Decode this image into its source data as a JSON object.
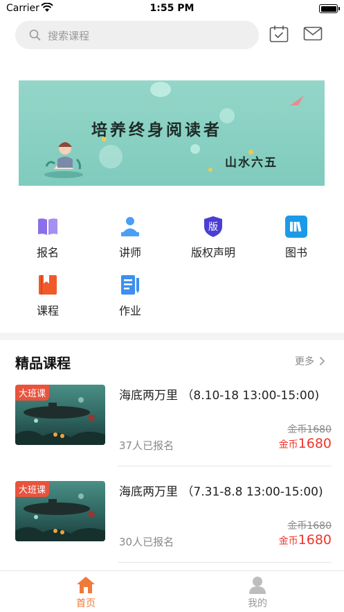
{
  "status_bar": {
    "carrier": "Carrier",
    "time": "1:55 PM"
  },
  "search": {
    "placeholder": "搜索课程"
  },
  "banner": {
    "title": "培养终身阅读者",
    "subtitle": "山水六五"
  },
  "grid": [
    {
      "label": "报名",
      "icon": "open-book-icon",
      "color": "#8b6fe8"
    },
    {
      "label": "讲师",
      "icon": "lecturer-icon",
      "color": "#4a9ff5"
    },
    {
      "label": "版权声明",
      "icon": "copyright-shield-icon",
      "color": "#4b3fd1",
      "glyph": "版"
    },
    {
      "label": "图书",
      "icon": "books-icon",
      "color": "#1b9ae8"
    },
    {
      "label": "课程",
      "icon": "course-book-icon",
      "color": "#f05a2a"
    },
    {
      "label": "作业",
      "icon": "homework-icon",
      "color": "#3d8ff0"
    }
  ],
  "section": {
    "title": "精品课程",
    "more": "更多"
  },
  "courses": [
    {
      "tag": "大班课",
      "title": "海底两万里 （8.10-18 13:00-15:00)",
      "enrolled": "37人已报名",
      "old_price": "金币1680",
      "price_unit": "金币",
      "price": "1680"
    },
    {
      "tag": "大班课",
      "title": "海底两万里 （7.31-8.8 13:00-15:00)",
      "enrolled": "30人已报名",
      "old_price": "金币1680",
      "price_unit": "金币",
      "price": "1680"
    }
  ],
  "tabs": [
    {
      "label": "首页",
      "icon": "home-icon",
      "active": true
    },
    {
      "label": "我的",
      "icon": "profile-icon",
      "active": false
    }
  ],
  "colors": {
    "accent": "#f07a3a",
    "price": "#f0342a",
    "tag": "#e9533d",
    "banner": "#8fd4c7"
  }
}
